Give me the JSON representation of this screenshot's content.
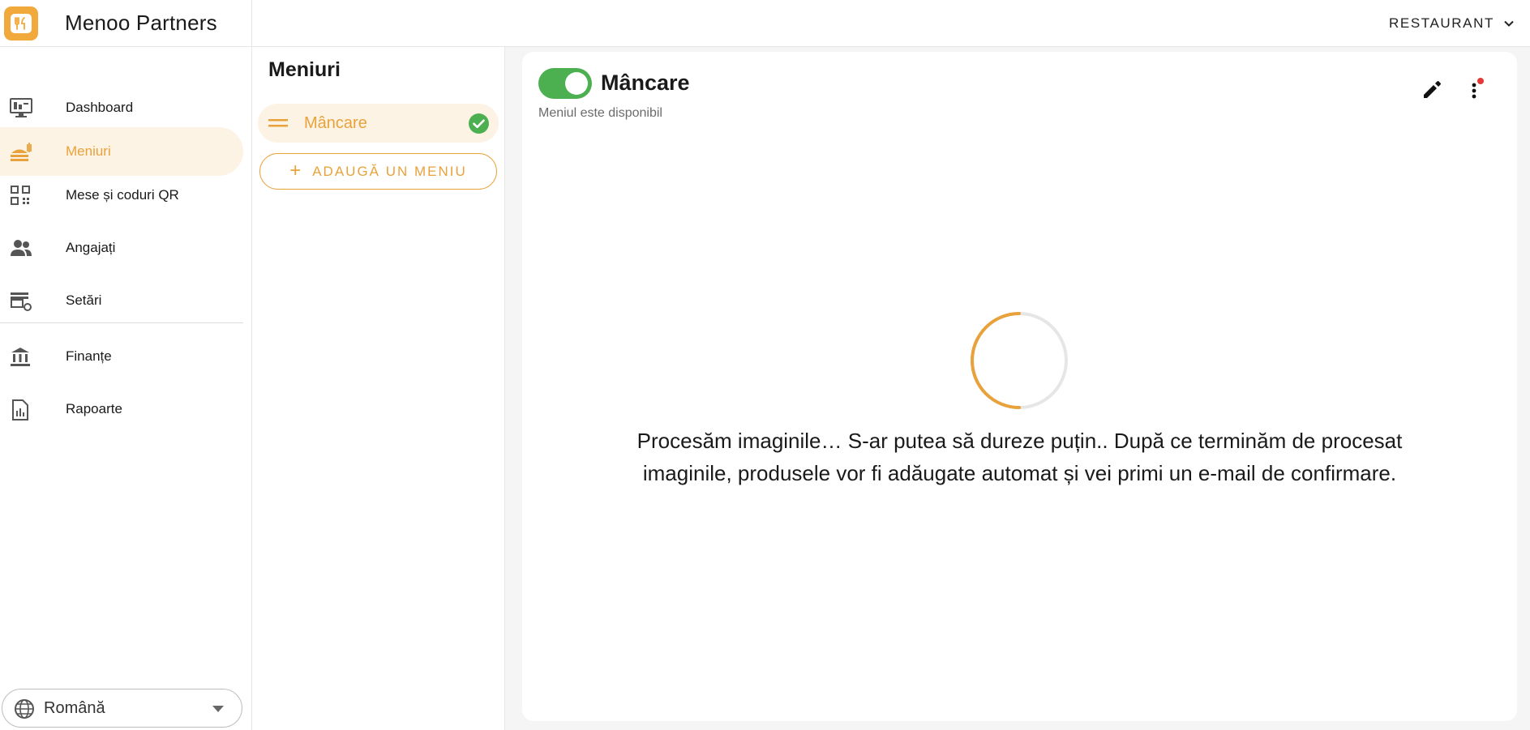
{
  "app": {
    "title": "Menoo Partners",
    "restaurant_label": "RESTAURANT",
    "accent_color": "#e9a23b"
  },
  "sidebar": {
    "items": [
      {
        "label": "Dashboard",
        "icon": "monitor-icon"
      },
      {
        "label": "Meniuri",
        "icon": "food-icon",
        "active": true
      },
      {
        "label": "Mese și coduri QR",
        "icon": "qr-code-icon"
      },
      {
        "label": "Angajați",
        "icon": "people-icon"
      },
      {
        "label": "Setări",
        "icon": "store-settings-icon"
      },
      {
        "label": "Finanțe",
        "icon": "bank-icon"
      },
      {
        "label": "Rapoarte",
        "icon": "report-icon"
      }
    ],
    "language": "Română"
  },
  "menus": {
    "title": "Meniuri",
    "items": [
      {
        "label": "Mâncare",
        "selected": true
      }
    ],
    "add_label": "ADAUGĂ UN MENIU",
    "add_icon": "+"
  },
  "detail": {
    "title": "Mâncare",
    "subtitle": "Meniul este disponibil",
    "available": true,
    "processing_message": "Procesăm imaginile… S-ar putea să dureze puțin.. După ce terminăm de procesat imaginile, produsele vor fi adăugate automat și vei primi un e-mail de confirmare.",
    "status_colors": {
      "toggle_on": "#4caf50",
      "notification_dot": "#e53935"
    }
  }
}
